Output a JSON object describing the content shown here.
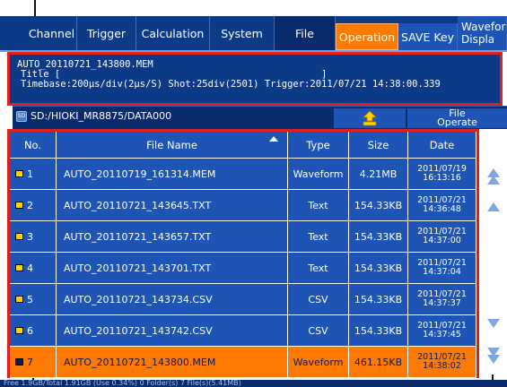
{
  "tabs": {
    "channel": "Channel",
    "trigger": "Trigger",
    "calculation": "Calculation",
    "system": "System",
    "file": "File",
    "operation": "Operation",
    "save_key": "SAVE Key",
    "waveform_display_1": "Wavefor",
    "waveform_display_2": "Displa"
  },
  "info_panel": {
    "filename": "AUTO_20110721_143800.MEM",
    "title_line": "Title [                                              ]",
    "timebase_line": "Timebase:200µs/div(2µs/S) Shot:25div(2501) Trigger:2011/07/21 14:38:00.339"
  },
  "path_bar": {
    "sd_label": "SD",
    "path": "SD:/HIOKI_MR8875/DATA000",
    "file_operate_1": "File",
    "file_operate_2": "Operate"
  },
  "table": {
    "headers": {
      "no": "No.",
      "name": "File Name",
      "type": "Type",
      "size": "Size",
      "date": "Date"
    },
    "rows": [
      {
        "no": "1",
        "name": "AUTO_20110719_161314.MEM",
        "type": "Waveform",
        "size": "4.21MB",
        "date1": "2011/07/19",
        "date2": "16:13:16"
      },
      {
        "no": "2",
        "name": "AUTO_20110721_143645.TXT",
        "type": "Text",
        "size": "154.33KB",
        "date1": "2011/07/21",
        "date2": "14:36:48"
      },
      {
        "no": "3",
        "name": "AUTO_20110721_143657.TXT",
        "type": "Text",
        "size": "154.33KB",
        "date1": "2011/07/21",
        "date2": "14:37:00"
      },
      {
        "no": "4",
        "name": "AUTO_20110721_143701.TXT",
        "type": "Text",
        "size": "154.33KB",
        "date1": "2011/07/21",
        "date2": "14:37:04"
      },
      {
        "no": "5",
        "name": "AUTO_20110721_143734.CSV",
        "type": "CSV",
        "size": "154.33KB",
        "date1": "2011/07/21",
        "date2": "14:37:37"
      },
      {
        "no": "6",
        "name": "AUTO_20110721_143742.CSV",
        "type": "CSV",
        "size": "154.33KB",
        "date1": "2011/07/21",
        "date2": "14:37:45"
      },
      {
        "no": "7",
        "name": "AUTO_20110721_143800.MEM",
        "type": "Waveform",
        "size": "461.15KB",
        "date1": "2011/07/21",
        "date2": "14:38:02"
      }
    ],
    "selected_index": 6
  },
  "status_bar": {
    "text": "Free 1.9GB/Total 1.91GB (Use 0.34%)   0 Folder(s) 7 File(s)(5.41MB)"
  },
  "colors": {
    "panel_dark": "#0a2a6e",
    "panel_blue": "#1d54b6",
    "selection": "#ff7a00",
    "highlight_border": "#e0201f"
  },
  "icons": [
    "sd-card-icon",
    "folder-up-icon",
    "document-icon",
    "scroll-top-icon",
    "scroll-up-icon",
    "scroll-down-icon",
    "scroll-bottom-icon"
  ]
}
